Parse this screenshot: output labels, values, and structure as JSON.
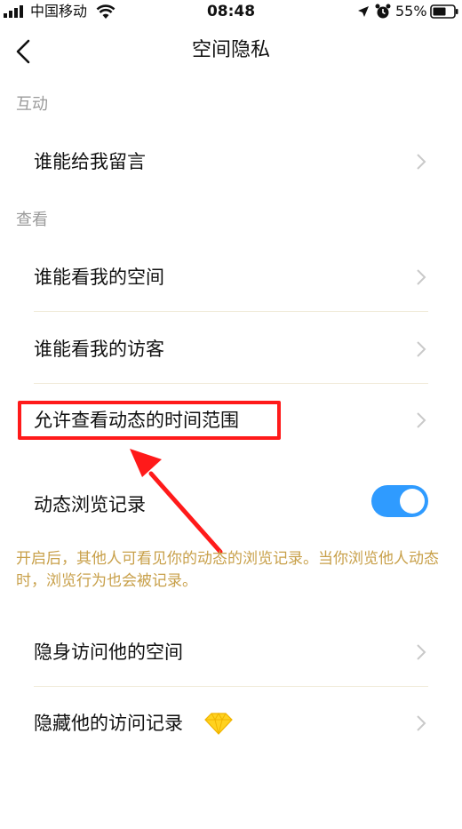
{
  "status_bar": {
    "carrier": "中国移动",
    "time": "08:48",
    "battery_percent": "55%"
  },
  "nav": {
    "title": "空间隐私"
  },
  "sections": {
    "interaction": {
      "header": "互动",
      "items": [
        {
          "label": "谁能给我留言"
        }
      ]
    },
    "view": {
      "header": "查看",
      "items": [
        {
          "label": "谁能看我的空间"
        },
        {
          "label": "谁能看我的访客"
        },
        {
          "label": "允许查看动态的时间范围"
        }
      ]
    }
  },
  "toggle_row": {
    "label": "动态浏览记录",
    "enabled": true,
    "description": "开启后，其他人可看见你的动态的浏览记录。当你浏览他人动态时，浏览行为也会被记录。"
  },
  "stealth": {
    "items": [
      {
        "label": "隐身访问他的空间"
      },
      {
        "label": "隐藏他的访问记录"
      }
    ]
  },
  "colors": {
    "accent_toggle": "#2f9bff",
    "description_text": "#c8a04a",
    "annotation_red": "#ff1a1a",
    "section_header": "#9a9a9a"
  },
  "icons": {
    "back": "back-arrow-icon",
    "chevron": "chevron-right-icon",
    "vip": "diamond-icon"
  }
}
